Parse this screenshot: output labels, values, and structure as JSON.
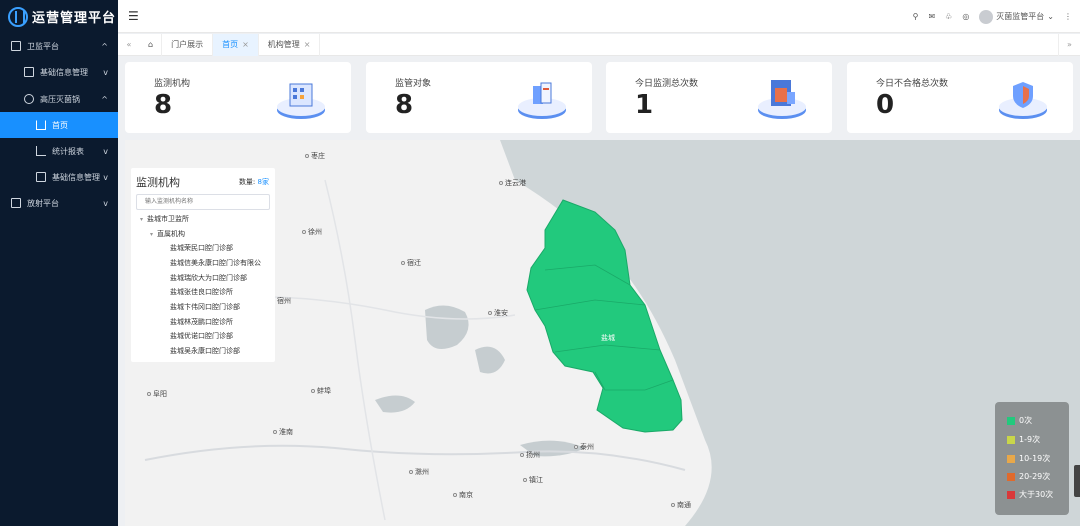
{
  "app": {
    "title": "运营管理平台"
  },
  "sidebar": {
    "items": [
      {
        "label": "卫监平台",
        "icon": "monitor-icon"
      },
      {
        "label": "基础信息管理",
        "icon": "grid-icon"
      },
      {
        "label": "高压灭菌锅",
        "icon": "circle-icon"
      },
      {
        "label": "首页",
        "icon": "home-icon"
      },
      {
        "label": "统计报表",
        "icon": "chart-icon"
      },
      {
        "label": "基础信息管理",
        "icon": "clipboard-icon"
      },
      {
        "label": "放射平台",
        "icon": "radiation-icon"
      }
    ]
  },
  "header": {
    "user": "灭菌监管平台"
  },
  "tabs": [
    {
      "label": "门户展示"
    },
    {
      "label": "首页"
    },
    {
      "label": "机构管理"
    }
  ],
  "cards": [
    {
      "label": "监测机构",
      "value": "8"
    },
    {
      "label": "监管对象",
      "value": "8"
    },
    {
      "label": "今日监测总次数",
      "value": "1"
    },
    {
      "label": "今日不合格总次数",
      "value": "0"
    }
  ],
  "map": {
    "cities": [
      "枣庄",
      "连云港",
      "徐州",
      "宿迁",
      "淮安",
      "阜阳",
      "蚌埠",
      "淮南",
      "滁州",
      "扬州",
      "泰州",
      "镇江",
      "南京",
      "南通",
      "宿州",
      "盐城"
    ]
  },
  "panel": {
    "title": "监测机构",
    "count_label": "数量:",
    "count_value": "8家",
    "search_placeholder": "输入监测机构名称",
    "root": "盐城市卫监所",
    "group": "直属机构",
    "items": [
      "盐城荣民口腔门诊部",
      "盐城信美永康口腔门诊有限公",
      "盐城瑞欣大为口腔门诊部",
      "盐城张佳良口腔诊所",
      "盐城卞伟冈口腔门诊部",
      "盐城林茂鹏口腔诊所",
      "盐城优诺口腔门诊部",
      "盐城吴永康口腔门诊部"
    ]
  },
  "legend": [
    {
      "label": "0次",
      "color": "#22c97d"
    },
    {
      "label": "1-9次",
      "color": "#c9d64a"
    },
    {
      "label": "10-19次",
      "color": "#e8a84a"
    },
    {
      "label": "20-29次",
      "color": "#e06a2c"
    },
    {
      "label": "大于30次",
      "color": "#d9383a"
    }
  ]
}
